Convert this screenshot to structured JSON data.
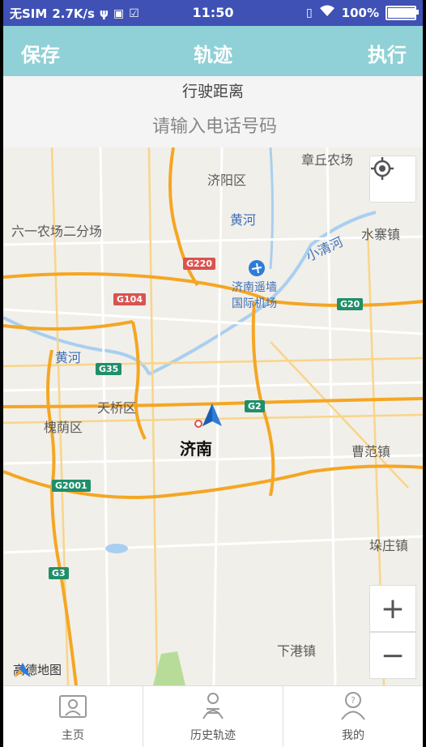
{
  "status_bar": {
    "carrier": "无SIM",
    "speed": "2.7K/s",
    "time": "11:50",
    "battery": "100%",
    "battery_level": 1.0
  },
  "title_bar": {
    "save_label": "保存",
    "title": "轨迹",
    "execute_label": "执行"
  },
  "info": {
    "distance_label": "行驶距离",
    "phone_placeholder": "请输入电话号码",
    "phone_value": ""
  },
  "map": {
    "labels": {
      "zhangqiu": "章丘农场",
      "jiyang": "济阳区",
      "yellow_river_1": "黄河",
      "liuyi": "六一农场二分场",
      "shuizhai": "水寨镇",
      "xiaoqinghe": "小清河",
      "airport_1": "济南遥墙",
      "airport_2": "国际机场",
      "yellow_river_2": "黄河",
      "tianqiao": "天桥区",
      "huaiyin": "槐荫区",
      "jinan": "济南",
      "caofan": "曹范镇",
      "duozhuang": "垛庄镇",
      "xiagang": "下港镇"
    },
    "shields": {
      "g220": "G220",
      "g104": "G104",
      "g20": "G20",
      "g35": "G35",
      "g2": "G2",
      "g2001": "G2001",
      "g3": "G3"
    },
    "logo_text": "高德地图",
    "zoom_in": "+",
    "zoom_out": "−"
  },
  "tabs": [
    {
      "label": "主页",
      "icon": "home-icon"
    },
    {
      "label": "历史轨迹",
      "icon": "history-icon"
    },
    {
      "label": "我的",
      "icon": "profile-icon"
    }
  ],
  "colors": {
    "status_bar": "#3f51b5",
    "title_bar": "#8fd1d6",
    "road_major": "#f5a623",
    "river": "#a9cff0"
  }
}
